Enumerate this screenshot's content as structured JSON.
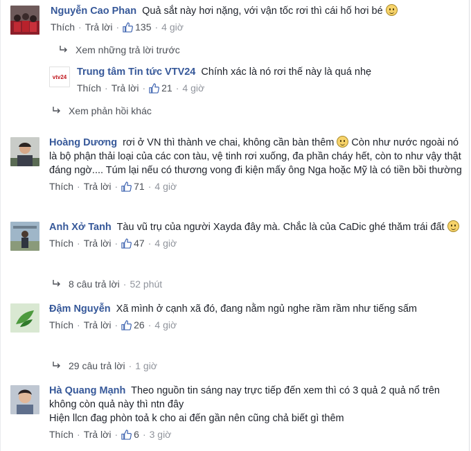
{
  "common": {
    "like": "Thích",
    "reply": "Trả lời",
    "dot": "·"
  },
  "comments": [
    {
      "name": "Nguyễn Cao Phan",
      "text": "Quả sắt này hơi nặng, với vận tốc rơi thì cái hố hơi bé",
      "likes": "135",
      "time": "4 giờ"
    },
    {
      "name": "Hoàng Dương",
      "text": "rơi ở VN thì thành ve chai, không cần bàn thêm",
      "text2": "Còn như nước ngoài nó là bộ phận thải loại của các con tàu, vệ tinh rơi xuống, đa phần cháy hết, còn to như vậy thật đáng ngờ.... Túm lại nếu có thương vong đi kiện mấy ông Nga hoặc Mỹ là có tiền bồi thường",
      "likes": "71",
      "time": "4 giờ"
    },
    {
      "name": "Anh Xở Tanh",
      "text": "Tàu vũ trụ của người Xayda đây mà. Chắc là của CaDic ghé thăm trái đất",
      "likes": "47",
      "time": "4 giờ",
      "replies_count": "8 câu trả lời",
      "replies_time": "52 phút"
    },
    {
      "name": "Đậm Nguyễn",
      "text": "Xã mình ở cạnh xã đó, đang nằm ngủ nghe rầm rầm như tiếng sấm",
      "likes": "26",
      "time": "4 giờ",
      "replies_count": "29 câu trả lời",
      "replies_time": "1 giờ"
    },
    {
      "name": "Hà Quang Mạnh",
      "text": "Theo nguồn tin sáng nay trực tiếp đến xem thì có 3 quả 2 quả nổ trên không còn quả này thì ntn đây",
      "text2": "Hiện llcn đag phòn toả k cho ai đến gần nên cũng chả biết gì thêm",
      "likes": "6",
      "time": "3 giờ"
    }
  ],
  "thread1": {
    "previous_replies": "Xem những trả lời trước",
    "reply": {
      "name": "Trung tâm Tin tức VTV24",
      "text": "Chính xác là nó rơi thế này là quá nhẹ",
      "likes": "21",
      "time": "4 giờ",
      "avatar_text": "vtv24"
    },
    "more_replies": "Xem phản hồi khác"
  },
  "colors": {
    "name": "#365899",
    "meta": "#90949c",
    "link": "#4b4f56"
  }
}
